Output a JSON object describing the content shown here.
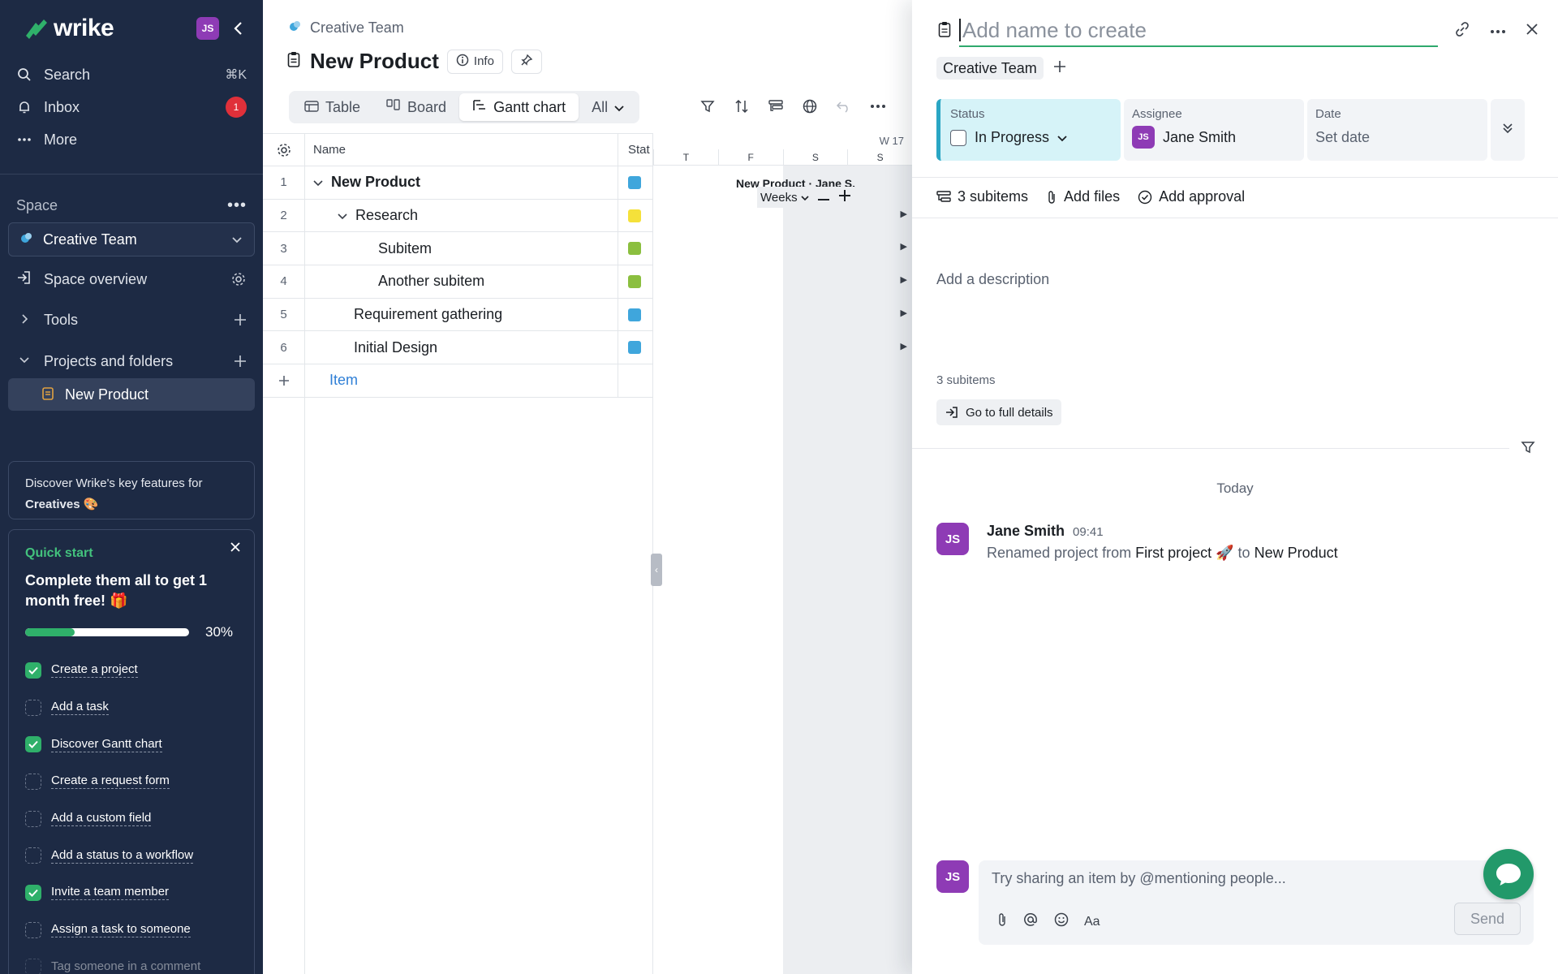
{
  "sidebar": {
    "logo_text": "wrike",
    "user_initials": "JS",
    "nav": [
      {
        "label": "Search",
        "shortcut": "⌘K",
        "icon": "search-icon"
      },
      {
        "label": "Inbox",
        "badge": "1",
        "icon": "bell-icon"
      },
      {
        "label": "More",
        "icon": "more-dots-icon"
      }
    ],
    "space_label": "Space",
    "space_selected": "Creative Team",
    "space_overview": "Space overview",
    "tools": "Tools",
    "projects_folders": "Projects and folders",
    "project_item": "New Product",
    "discover": {
      "line1": "Discover Wrike's key features for",
      "line2": "Creatives 🎨"
    },
    "quick_start": {
      "label": "Quick start",
      "title": "Complete them all to get 1 month free! 🎁",
      "progress_percent": 30,
      "progress_text": "30%",
      "items": [
        {
          "label": "Create a project",
          "done": true
        },
        {
          "label": "Add a task",
          "done": false
        },
        {
          "label": "Discover Gantt chart",
          "done": true
        },
        {
          "label": "Create a request form",
          "done": false
        },
        {
          "label": "Add a custom field",
          "done": false
        },
        {
          "label": "Add a status to a workflow",
          "done": false
        },
        {
          "label": "Invite a team member",
          "done": true
        },
        {
          "label": "Assign a task to someone",
          "done": false
        },
        {
          "label": "Tag someone in a comment",
          "done": false
        }
      ]
    }
  },
  "main": {
    "breadcrumb": "Creative Team",
    "title": "New Product",
    "info_label": "Info",
    "tabs": [
      {
        "label": "Table",
        "active": false
      },
      {
        "label": "Board",
        "active": false
      },
      {
        "label": "Gantt chart",
        "active": true
      }
    ],
    "filter_all": "All",
    "table": {
      "col_name": "Name",
      "col_status": "Stat",
      "rows": [
        {
          "num": "1",
          "name": "New Product",
          "color": "#3fa6dc",
          "bold": true,
          "expand": true
        },
        {
          "num": "2",
          "name": "Research",
          "color": "#f5e13a",
          "bold": false,
          "expand": true
        },
        {
          "num": "3",
          "name": "Subitem",
          "color": "#8bbf3f",
          "bold": false,
          "expand": false
        },
        {
          "num": "4",
          "name": "Another subitem",
          "color": "#8bbf3f",
          "bold": false,
          "expand": false
        },
        {
          "num": "5",
          "name": "Requirement gathering",
          "color": "#3fa6dc",
          "bold": false,
          "expand": false
        },
        {
          "num": "6",
          "name": "Initial Design",
          "color": "#3fa6dc",
          "bold": false,
          "expand": false
        }
      ],
      "add_item": "Item"
    },
    "gantt": {
      "week": "W 17",
      "days": [
        "T",
        "F",
        "S",
        "S"
      ],
      "bar_label": "New Product · Jane S.",
      "scale": "Weeks"
    }
  },
  "panel": {
    "title_placeholder": "Add name to create",
    "tag": "Creative Team",
    "status_label": "Status",
    "status_value": "In Progress",
    "assignee_label": "Assignee",
    "assignee_value": "Jane Smith",
    "assignee_initials": "JS",
    "date_label": "Date",
    "date_value": "Set date",
    "subitems_action": "3 subitems",
    "add_files": "Add files",
    "add_approval": "Add approval",
    "description_placeholder": "Add a description",
    "subitems_count": "3 subitems",
    "go_full_details": "Go to full details",
    "today": "Today",
    "activity": {
      "author": "Jane Smith",
      "initials": "JS",
      "time": "09:41",
      "prefix": "Renamed project from",
      "from": "First project 🚀",
      "to_word": "to",
      "to": "New Product"
    },
    "composer_placeholder": "Try sharing an item by @mentioning people...",
    "composer_initials": "JS",
    "send": "Send",
    "text_format": "Aa"
  }
}
